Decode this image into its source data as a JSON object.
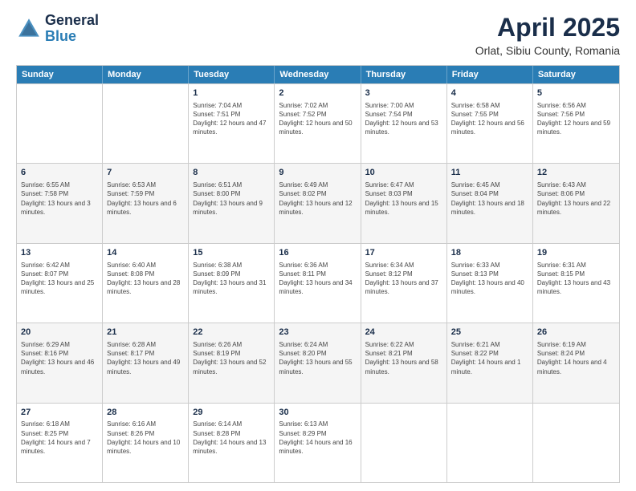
{
  "header": {
    "logo_general": "General",
    "logo_blue": "Blue",
    "month_title": "April 2025",
    "location": "Orlat, Sibiu County, Romania"
  },
  "calendar": {
    "days_of_week": [
      "Sunday",
      "Monday",
      "Tuesday",
      "Wednesday",
      "Thursday",
      "Friday",
      "Saturday"
    ],
    "weeks": [
      [
        {
          "day": "",
          "info": ""
        },
        {
          "day": "",
          "info": ""
        },
        {
          "day": "1",
          "info": "Sunrise: 7:04 AM\nSunset: 7:51 PM\nDaylight: 12 hours and 47 minutes."
        },
        {
          "day": "2",
          "info": "Sunrise: 7:02 AM\nSunset: 7:52 PM\nDaylight: 12 hours and 50 minutes."
        },
        {
          "day": "3",
          "info": "Sunrise: 7:00 AM\nSunset: 7:54 PM\nDaylight: 12 hours and 53 minutes."
        },
        {
          "day": "4",
          "info": "Sunrise: 6:58 AM\nSunset: 7:55 PM\nDaylight: 12 hours and 56 minutes."
        },
        {
          "day": "5",
          "info": "Sunrise: 6:56 AM\nSunset: 7:56 PM\nDaylight: 12 hours and 59 minutes."
        }
      ],
      [
        {
          "day": "6",
          "info": "Sunrise: 6:55 AM\nSunset: 7:58 PM\nDaylight: 13 hours and 3 minutes."
        },
        {
          "day": "7",
          "info": "Sunrise: 6:53 AM\nSunset: 7:59 PM\nDaylight: 13 hours and 6 minutes."
        },
        {
          "day": "8",
          "info": "Sunrise: 6:51 AM\nSunset: 8:00 PM\nDaylight: 13 hours and 9 minutes."
        },
        {
          "day": "9",
          "info": "Sunrise: 6:49 AM\nSunset: 8:02 PM\nDaylight: 13 hours and 12 minutes."
        },
        {
          "day": "10",
          "info": "Sunrise: 6:47 AM\nSunset: 8:03 PM\nDaylight: 13 hours and 15 minutes."
        },
        {
          "day": "11",
          "info": "Sunrise: 6:45 AM\nSunset: 8:04 PM\nDaylight: 13 hours and 18 minutes."
        },
        {
          "day": "12",
          "info": "Sunrise: 6:43 AM\nSunset: 8:06 PM\nDaylight: 13 hours and 22 minutes."
        }
      ],
      [
        {
          "day": "13",
          "info": "Sunrise: 6:42 AM\nSunset: 8:07 PM\nDaylight: 13 hours and 25 minutes."
        },
        {
          "day": "14",
          "info": "Sunrise: 6:40 AM\nSunset: 8:08 PM\nDaylight: 13 hours and 28 minutes."
        },
        {
          "day": "15",
          "info": "Sunrise: 6:38 AM\nSunset: 8:09 PM\nDaylight: 13 hours and 31 minutes."
        },
        {
          "day": "16",
          "info": "Sunrise: 6:36 AM\nSunset: 8:11 PM\nDaylight: 13 hours and 34 minutes."
        },
        {
          "day": "17",
          "info": "Sunrise: 6:34 AM\nSunset: 8:12 PM\nDaylight: 13 hours and 37 minutes."
        },
        {
          "day": "18",
          "info": "Sunrise: 6:33 AM\nSunset: 8:13 PM\nDaylight: 13 hours and 40 minutes."
        },
        {
          "day": "19",
          "info": "Sunrise: 6:31 AM\nSunset: 8:15 PM\nDaylight: 13 hours and 43 minutes."
        }
      ],
      [
        {
          "day": "20",
          "info": "Sunrise: 6:29 AM\nSunset: 8:16 PM\nDaylight: 13 hours and 46 minutes."
        },
        {
          "day": "21",
          "info": "Sunrise: 6:28 AM\nSunset: 8:17 PM\nDaylight: 13 hours and 49 minutes."
        },
        {
          "day": "22",
          "info": "Sunrise: 6:26 AM\nSunset: 8:19 PM\nDaylight: 13 hours and 52 minutes."
        },
        {
          "day": "23",
          "info": "Sunrise: 6:24 AM\nSunset: 8:20 PM\nDaylight: 13 hours and 55 minutes."
        },
        {
          "day": "24",
          "info": "Sunrise: 6:22 AM\nSunset: 8:21 PM\nDaylight: 13 hours and 58 minutes."
        },
        {
          "day": "25",
          "info": "Sunrise: 6:21 AM\nSunset: 8:22 PM\nDaylight: 14 hours and 1 minute."
        },
        {
          "day": "26",
          "info": "Sunrise: 6:19 AM\nSunset: 8:24 PM\nDaylight: 14 hours and 4 minutes."
        }
      ],
      [
        {
          "day": "27",
          "info": "Sunrise: 6:18 AM\nSunset: 8:25 PM\nDaylight: 14 hours and 7 minutes."
        },
        {
          "day": "28",
          "info": "Sunrise: 6:16 AM\nSunset: 8:26 PM\nDaylight: 14 hours and 10 minutes."
        },
        {
          "day": "29",
          "info": "Sunrise: 6:14 AM\nSunset: 8:28 PM\nDaylight: 14 hours and 13 minutes."
        },
        {
          "day": "30",
          "info": "Sunrise: 6:13 AM\nSunset: 8:29 PM\nDaylight: 14 hours and 16 minutes."
        },
        {
          "day": "",
          "info": ""
        },
        {
          "day": "",
          "info": ""
        },
        {
          "day": "",
          "info": ""
        }
      ]
    ]
  }
}
